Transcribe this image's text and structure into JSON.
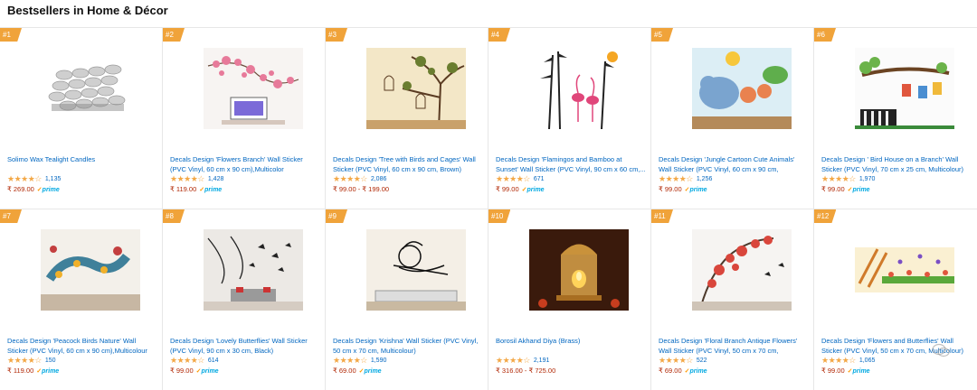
{
  "page": {
    "title": "Bestsellers in Home & Décor"
  },
  "products": [
    {
      "rank": "#1",
      "image": "tealight-candles",
      "title": "Solimo Wax Tealight Candles",
      "stars": "★★★★☆",
      "reviews": "1,135",
      "price": "₹ 269.00",
      "prime": "prime"
    },
    {
      "rank": "#2",
      "image": "flowers-branch-sticker",
      "title": "Decals Design 'Flowers Branch' Wall Sticker (PVC Vinyl, 60 cm x 90 cm),Multicolor",
      "stars": "★★★★☆",
      "reviews": "1,428",
      "price": "₹ 119.00",
      "prime": "prime"
    },
    {
      "rank": "#3",
      "image": "tree-birds-cages-sticker",
      "title": "Decals Design 'Tree with Birds and Cages' Wall Sticker (PVC Vinyl, 60 cm x 90 cm, Brown)",
      "stars": "★★★★☆",
      "reviews": "2,086",
      "price": "₹ 99.00 - ₹ 199.00",
      "prime": ""
    },
    {
      "rank": "#4",
      "image": "flamingos-bamboo-sticker",
      "title": "Decals Design 'Flamingos and Bamboo at Sunset' Wall Sticker (PVC Vinyl, 90 cm x 60 cm,...",
      "stars": "★★★★☆",
      "reviews": "671",
      "price": "₹ 99.00",
      "prime": "prime"
    },
    {
      "rank": "#5",
      "image": "cartoon-animals-sticker",
      "title": "Decals Design 'Jungle Cartoon Cute Animals' Wall Sticker (PVC Vinyl, 60 cm x 90 cm, Multicolour)",
      "stars": "★★★★☆",
      "reviews": "1,256",
      "price": "₹ 99.00",
      "prime": "prime"
    },
    {
      "rank": "#6",
      "image": "bird-house-branch-sticker",
      "title": "Decals Design ' Bird House on a Branch' Wall Sticker (PVC Vinyl, 70 cm x 25 cm, Multicolour)",
      "stars": "★★★★☆",
      "reviews": "1,970",
      "price": "₹ 99.00",
      "prime": "prime"
    },
    {
      "rank": "#7",
      "image": "peacock-birds-sticker",
      "title": "Decals Design 'Peacock Birds Nature' Wall Sticker (PVC Vinyl, 60 cm x 90 cm),Multicolour",
      "stars": "★★★★☆",
      "reviews": "150",
      "price": "₹ 119.00",
      "prime": "prime"
    },
    {
      "rank": "#8",
      "image": "lovely-butterflies-sticker",
      "title": "Decals Design 'Lovely Butterflies' Wall Sticker (PVC Vinyl, 90 cm x 30 cm, Black)",
      "stars": "★★★★☆",
      "reviews": "614",
      "price": "₹ 99.00",
      "prime": "prime"
    },
    {
      "rank": "#9",
      "image": "krishna-sticker",
      "title": "Decals Design 'Krishna' Wall Sticker (PVC Vinyl, 50 cm x 70 cm, Multicolour)",
      "stars": "★★★★☆",
      "reviews": "1,590",
      "price": "₹ 69.00",
      "prime": "prime"
    },
    {
      "rank": "#10",
      "image": "akhand-diya-brass",
      "title": "Borosil Akhand Diya (Brass)",
      "stars": "★★★★☆",
      "reviews": "2,191",
      "price": "₹ 316.00 - ₹ 725.00",
      "prime": ""
    },
    {
      "rank": "#11",
      "image": "floral-branch-sticker",
      "title": "Decals Design 'Floral Branch Antique Flowers' Wall Sticker (PVC Vinyl, 50 cm x 70 cm, Multicolour)",
      "stars": "★★★★☆",
      "reviews": "522",
      "price": "₹ 69.00",
      "prime": "prime"
    },
    {
      "rank": "#12",
      "image": "flowers-butterflies-sticker",
      "title": "Decals Design 'Flowers and Butterflies' Wall Sticker (PVC Vinyl, 50 cm x 70 cm, Multicolour)",
      "stars": "★★★★☆",
      "reviews": "1,065",
      "price": "₹ 99.00",
      "prime": "prime"
    }
  ],
  "watermark": {
    "icon": "wechat-icon"
  }
}
